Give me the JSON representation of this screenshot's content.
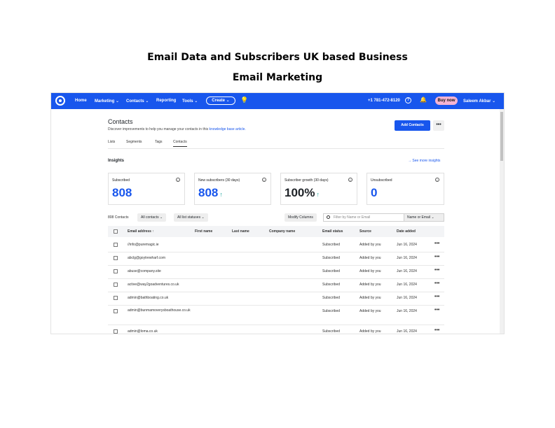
{
  "document": {
    "title_line1": "Email Data and Subscribers UK based Business",
    "title_line2": "Email Marketing"
  },
  "nav": {
    "items": [
      "Home",
      "Marketing",
      "Contacts",
      "Reporting",
      "Tools"
    ],
    "create": "Create",
    "phone": "+1 781-472-8120",
    "buy": "Buy now",
    "user": "Saleem Akbar"
  },
  "page": {
    "title": "Contacts",
    "description": "Discover improvements to help you manage your contacts in this",
    "description_link": "knowledge base article.",
    "add_button": "Add Contacts",
    "more_button": "•••"
  },
  "tabs": [
    "Lists",
    "Segments",
    "Tags",
    "Contacts"
  ],
  "active_tab": "Contacts",
  "insights": {
    "title": "Insights",
    "link": "See more insights",
    "cards": [
      {
        "label": "Subscribed",
        "value": "808",
        "arrow": ""
      },
      {
        "label": "New subscribers (30 days)",
        "value": "808",
        "arrow": "↑"
      },
      {
        "label": "Subscriber growth (30 days)",
        "value": "100%",
        "arrow": "↑"
      },
      {
        "label": "Unsubscribed",
        "value": "0",
        "arrow": ""
      }
    ]
  },
  "toolbar": {
    "count": "808 Contacts",
    "filter1": "All contacts",
    "filter2": "All list statuses",
    "modify": "Modify Columns",
    "search_placeholder": "Filter by Name or Email",
    "search_by": "Name or Email"
  },
  "table": {
    "headers": [
      "Email address",
      "First name",
      "Last name",
      "Company name",
      "Email status",
      "Source",
      "Date added"
    ],
    "rows": [
      {
        "email": "//info@puremagic.ie",
        "status": "Subscribed",
        "source": "Added by you",
        "date": "Jun 16, 2024"
      },
      {
        "email": "abclg@goytrewharf.com",
        "status": "Subscribed",
        "source": "Added by you",
        "date": "Jun 16, 2024"
      },
      {
        "email": "abuse@company.site",
        "status": "Subscribed",
        "source": "Added by you",
        "date": "Jun 16, 2024"
      },
      {
        "email": "active@way2goadventures.co.uk",
        "status": "Subscribed",
        "source": "Added by you",
        "date": "Jun 16, 2024"
      },
      {
        "email": "admin@bathboating.co.uk",
        "status": "Subscribed",
        "source": "Added by you",
        "date": "Jun 16, 2024"
      },
      {
        "email": "admin@bunmamoverysboathouse.co.uk",
        "status": "Subscribed",
        "source": "Added by you",
        "date": "Jun 16, 2024"
      },
      {
        "email": "admin@loma.co.uk",
        "status": "Subscribed",
        "source": "Added by you",
        "date": "Jun 16, 2024"
      }
    ],
    "row_menu": "•••"
  },
  "colors": {
    "nav": "#1856ed",
    "accent": "#1856ed",
    "buy": "#f6b4d2",
    "growth": "#1aa39b"
  }
}
